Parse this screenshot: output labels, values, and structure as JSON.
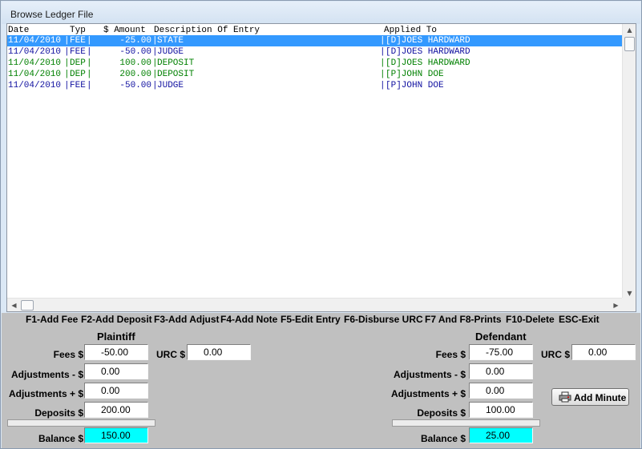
{
  "window": {
    "title": "Browse Ledger File"
  },
  "list": {
    "columns": [
      "Date",
      "Typ",
      "$ Amount",
      "Description Of Entry",
      "Applied To"
    ],
    "rows": [
      {
        "date": "11/04/2010",
        "typ": "FEE",
        "amount": "-25.00",
        "description": "STATE",
        "applied": "[D]JOES HARDWARD",
        "selected": true,
        "color": "#1010a0"
      },
      {
        "date": "11/04/2010",
        "typ": "FEE",
        "amount": "-50.00",
        "description": "JUDGE",
        "applied": "[D]JOES HARDWARD",
        "selected": false,
        "color": "#1010a0"
      },
      {
        "date": "11/04/2010",
        "typ": "DEP",
        "amount": "100.00",
        "description": "DEPOSIT",
        "applied": "[D]JOES HARDWARD",
        "selected": false,
        "color": "#008000"
      },
      {
        "date": "11/04/2010",
        "typ": "DEP",
        "amount": "200.00",
        "description": "DEPOSIT",
        "applied": "[P]JOHN DOE",
        "selected": false,
        "color": "#008000"
      },
      {
        "date": "11/04/2010",
        "typ": "FEE",
        "amount": "-50.00",
        "description": "JUDGE",
        "applied": "[P]JOHN DOE",
        "selected": false,
        "color": "#1010a0"
      }
    ],
    "separator": "|"
  },
  "function_keys": [
    "F1-Add Fee",
    "F2-Add Deposit",
    "F3-Add Adjust",
    "F4-Add Note",
    "F5-Edit Entry",
    "F6-Disburse URC",
    "F7 And F8-Prints",
    "F10-Delete",
    "ESC-Exit"
  ],
  "plaintiff": {
    "title": "Plaintiff",
    "fees_label": "Fees $",
    "fees": "-50.00",
    "urc_label": "URC $",
    "urc": "0.00",
    "adj_minus_label": "Adjustments - $",
    "adj_minus": "0.00",
    "adj_plus_label": "Adjustments + $",
    "adj_plus": "0.00",
    "deposits_label": "Deposits $",
    "deposits": "200.00",
    "balance_label": "Balance $",
    "balance": "150.00"
  },
  "defendant": {
    "title": "Defendant",
    "fees_label": "Fees $",
    "fees": "-75.00",
    "urc_label": "URC $",
    "urc": "0.00",
    "adj_minus_label": "Adjustments - $",
    "adj_minus": "0.00",
    "adj_plus_label": "Adjustments + $",
    "adj_plus": "0.00",
    "deposits_label": "Deposits $",
    "deposits": "100.00",
    "balance_label": "Balance $",
    "balance": "25.00"
  },
  "add_minute_button": {
    "label": "Add Minute",
    "icon": "printer-icon"
  },
  "colors": {
    "selection": "#3399ff",
    "fee_text": "#1010a0",
    "deposit_text": "#008000",
    "balance_field": "#00ffff"
  }
}
